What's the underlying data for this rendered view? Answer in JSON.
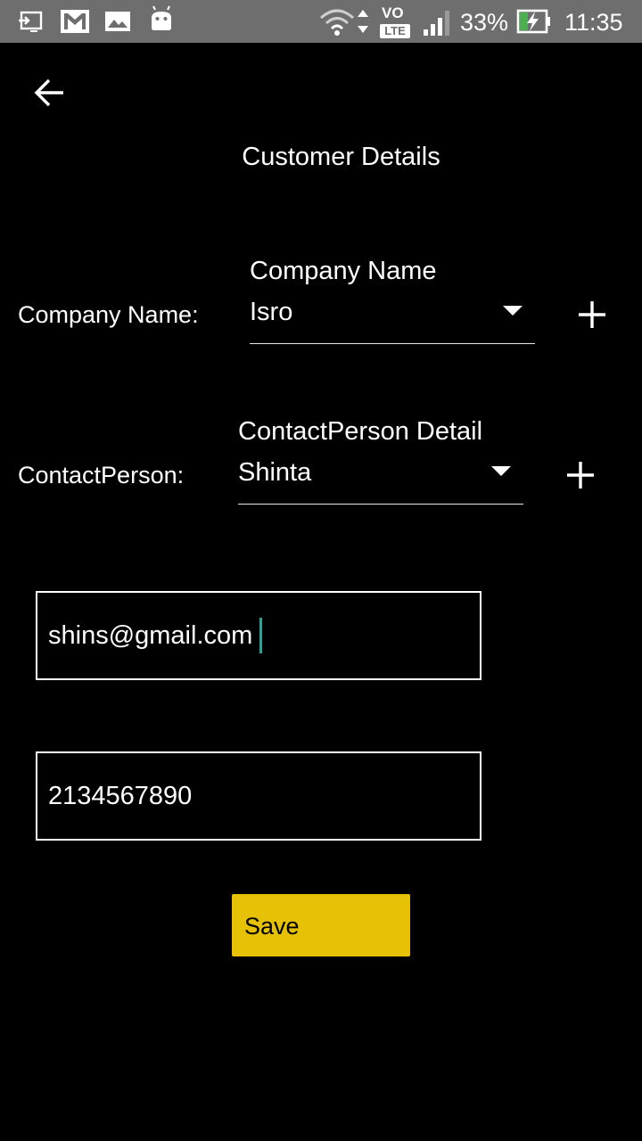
{
  "status_bar": {
    "battery_percent_text": "33%",
    "time": "11:35",
    "network_label_top": "VO",
    "network_label_bottom": "LTE",
    "icons": [
      "screen-cast-icon",
      "gmail-icon",
      "gallery-icon",
      "android-icon",
      "wifi-icon",
      "data-arrows-icon",
      "volte-icon",
      "signal-icon",
      "battery-charging-icon"
    ]
  },
  "header": {
    "back_icon": "arrow-left-icon",
    "title": "Customer Details"
  },
  "company": {
    "label": "Company Name:",
    "hint": "Company Name",
    "value": "Isro",
    "add_icon": "plus-icon"
  },
  "contact": {
    "label": "ContactPerson:",
    "hint": "ContactPerson Detail",
    "value": "Shinta",
    "add_icon": "plus-icon"
  },
  "email": {
    "value": "shins@gmail.com"
  },
  "phone": {
    "value": "2134567890"
  },
  "actions": {
    "save_label": "Save"
  },
  "colors": {
    "background": "#000000",
    "status_bar": "#6e6e6e",
    "save_button": "#e6c105",
    "caret": "#26a69a",
    "text": "#ffffff"
  }
}
